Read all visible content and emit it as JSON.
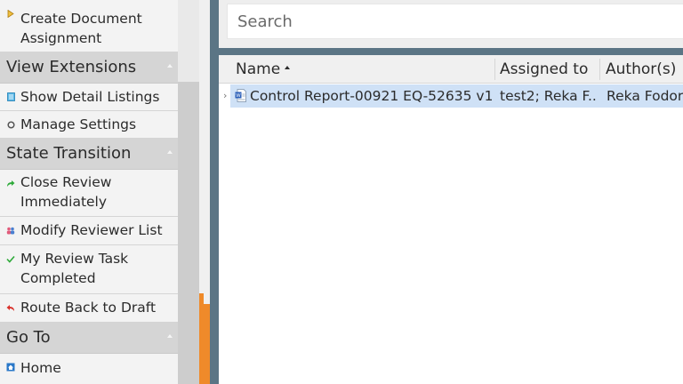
{
  "sidebar": {
    "top_items": [
      {
        "label": "Create Document\nAssignment",
        "icon": "play-arrow-icon",
        "color": "#d4a017"
      }
    ],
    "sections": [
      {
        "title": "View Extensions",
        "items": [
          {
            "label": "Show Detail Listings",
            "icon": "list-icon",
            "color": "#2a9fd6"
          },
          {
            "label": "Manage Settings",
            "icon": "gear-icon",
            "color": "#555555"
          }
        ]
      },
      {
        "title": "State Transition",
        "items": [
          {
            "label": "Close Review\nImmediately",
            "icon": "forward-arrow-icon",
            "color": "#2eaa3a"
          },
          {
            "label": "Modify Reviewer List",
            "icon": "people-icon",
            "color": "#d23a5a"
          },
          {
            "label": "My Review Task\nCompleted",
            "icon": "checkmark-icon",
            "color": "#2eaa3a"
          },
          {
            "label": "Route Back to Draft",
            "icon": "back-arrow-icon",
            "color": "#d9302a"
          }
        ]
      },
      {
        "title": "Go To",
        "items": [
          {
            "label": "Home",
            "icon": "home-icon",
            "color": "#2a78c8"
          }
        ]
      }
    ]
  },
  "search": {
    "placeholder": "Search"
  },
  "grid": {
    "columns": [
      {
        "key": "name",
        "label": "Name",
        "sorted": "asc"
      },
      {
        "key": "assigned",
        "label": "Assigned to"
      },
      {
        "key": "authors",
        "label": "Author(s)"
      }
    ],
    "rows": [
      {
        "name": "Control Report-00921 EQ-52635 v1",
        "assigned": "test2; Reka F...",
        "authors": "Reka Fodor",
        "icon": "word-document-icon",
        "selected": true
      }
    ]
  },
  "colors": {
    "accent_orange": "#ef8a2a",
    "frame": "#5b7585",
    "selection": "#cfe1f6",
    "section_header": "#d5d5d5"
  }
}
